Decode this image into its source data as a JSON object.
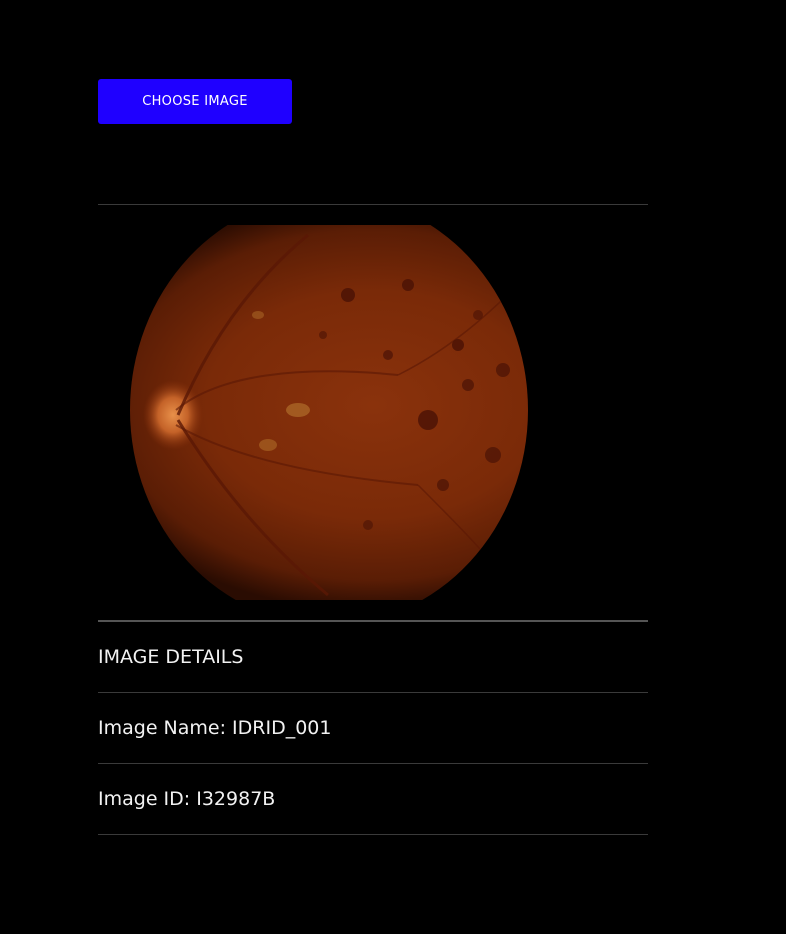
{
  "toolbar": {
    "choose_image_label": "CHOOSE IMAGE"
  },
  "details": {
    "heading": "IMAGE DETAILS",
    "name_label": "Image Name:",
    "name_value": "IDRID_001",
    "id_label": "Image ID:",
    "id_value": "I32987B"
  },
  "colors": {
    "background": "#000000",
    "accent_button": "#1f00ff",
    "fundus_base": "#7a2a08"
  },
  "icons": {
    "retina_image": "fundus-photo"
  }
}
